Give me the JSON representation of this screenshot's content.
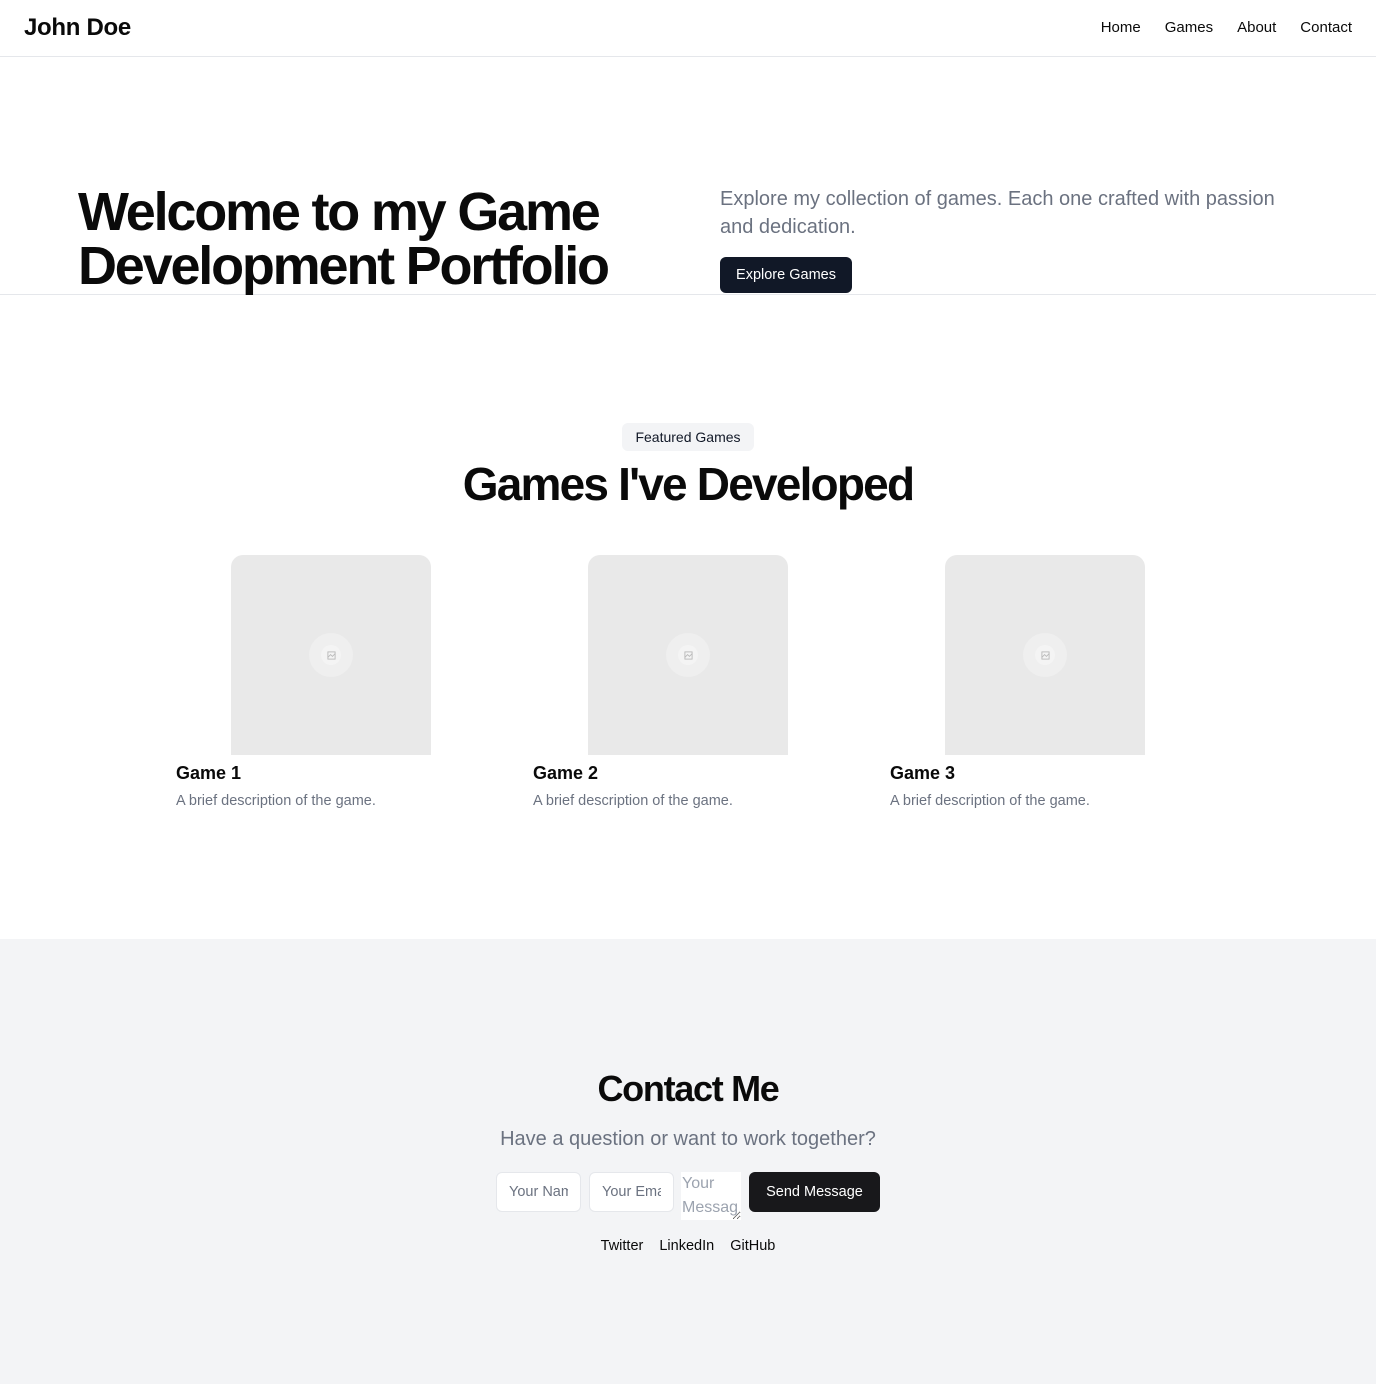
{
  "header": {
    "brand": "John Doe",
    "nav": [
      "Home",
      "Games",
      "About",
      "Contact"
    ]
  },
  "hero": {
    "title": "Welcome to my Game Development Portfolio",
    "subtitle": "Explore my collection of games. Each one crafted with passion and dedication.",
    "button_label": "Explore Games"
  },
  "games": {
    "badge": "Featured Games",
    "title": "Games I've Developed",
    "items": [
      {
        "title": "Game 1",
        "description": "A brief description of the game.",
        "image_icon": "image-placeholder-icon"
      },
      {
        "title": "Game 2",
        "description": "A brief description of the game.",
        "image_icon": "image-placeholder-icon"
      },
      {
        "title": "Game 3",
        "description": "A brief description of the game.",
        "image_icon": "image-placeholder-icon"
      }
    ]
  },
  "contact": {
    "title": "Contact Me",
    "subtitle": "Have a question or want to work together?",
    "name_placeholder": "Your Name",
    "email_placeholder": "Your Email",
    "message_placeholder": "Your Message",
    "send_label": "Send Message",
    "socials": [
      "Twitter",
      "LinkedIn",
      "GitHub"
    ]
  },
  "colors": {
    "primary_button": "#111827",
    "send_button": "#18181b",
    "muted_text": "#6b7280",
    "contact_bg": "#f3f4f6",
    "card_placeholder": "#e9e9e9"
  }
}
